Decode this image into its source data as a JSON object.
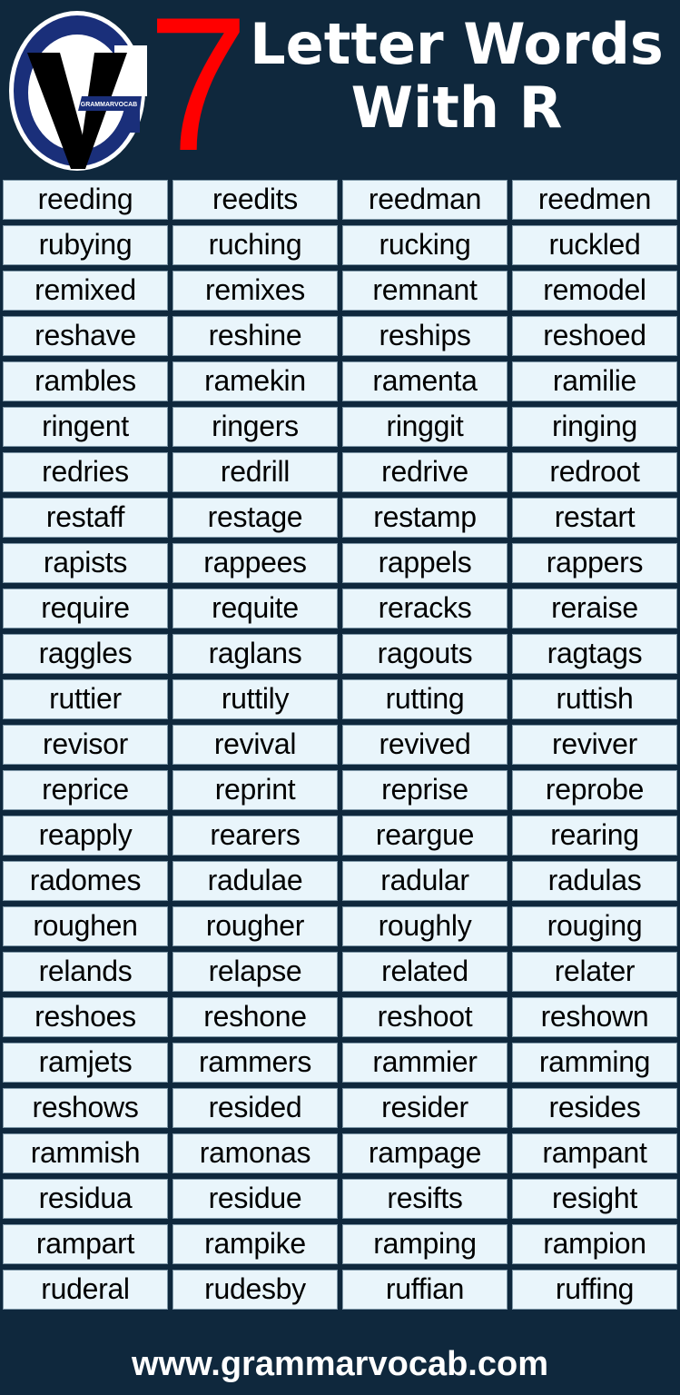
{
  "header": {
    "logo_text": "GRAMMARVOCAB",
    "number": "7",
    "title_line1": "Letter Words",
    "title_line2": "With R"
  },
  "colors": {
    "background": "#0f283d",
    "accent_red": "#ff0000",
    "cell_fill": "#e9f5fb",
    "logo_blue": "#1a2f7a"
  },
  "words": [
    [
      "reeding",
      "reedits",
      "reedman",
      "reedmen"
    ],
    [
      "rubying",
      "ruching",
      "rucking",
      "ruckled"
    ],
    [
      "remixed",
      "remixes",
      "remnant",
      "remodel"
    ],
    [
      "reshave",
      "reshine",
      "reships",
      "reshoed"
    ],
    [
      "rambles",
      "ramekin",
      "ramenta",
      "ramilie"
    ],
    [
      "ringent",
      "ringers",
      "ringgit",
      "ringing"
    ],
    [
      "redries",
      "redrill",
      "redrive",
      "redroot"
    ],
    [
      "restaff",
      "restage",
      "restamp",
      "restart"
    ],
    [
      "rapists",
      "rappees",
      "rappels",
      "rappers"
    ],
    [
      "require",
      "requite",
      "reracks",
      "reraise"
    ],
    [
      "raggles",
      "raglans",
      "ragouts",
      "ragtags"
    ],
    [
      "ruttier",
      "ruttily",
      "rutting",
      "ruttish"
    ],
    [
      "revisor",
      "revival",
      "revived",
      "reviver"
    ],
    [
      "reprice",
      "reprint",
      "reprise",
      "reprobe"
    ],
    [
      "reapply",
      "rearers",
      "reargue",
      "rearing"
    ],
    [
      "radomes",
      "radulae",
      "radular",
      "radulas"
    ],
    [
      "roughen",
      "rougher",
      "roughly",
      "rouging"
    ],
    [
      "relands",
      "relapse",
      "related",
      "relater"
    ],
    [
      "reshoes",
      "reshone",
      "reshoot",
      "reshown"
    ],
    [
      "ramjets",
      "rammers",
      "rammier",
      "ramming"
    ],
    [
      "reshows",
      "resided",
      "resider",
      "resides"
    ],
    [
      "rammish",
      "ramonas",
      "rampage",
      "rampant"
    ],
    [
      "residua",
      "residue",
      "resifts",
      "resight"
    ],
    [
      "rampart",
      "rampike",
      "ramping",
      "rampion"
    ],
    [
      "ruderal",
      "rudesby",
      "ruffian",
      "ruffing"
    ]
  ],
  "footer": {
    "website": "www.grammarvocab.com"
  }
}
